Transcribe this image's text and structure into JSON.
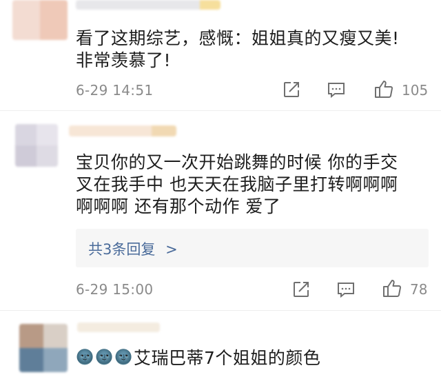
{
  "comments": [
    {
      "text_lines": [
        "看了这期综艺，感慨：姐姐真的又瘦又美!",
        "非常羡慕了!"
      ],
      "timestamp": "6-29 14:51",
      "likes": "105"
    },
    {
      "text_lines": [
        "宝贝你的又一次开始跳舞的时候 你的手交",
        "叉在我手中  也天天在我脑子里打转啊啊啊",
        "啊啊啊 还有那个动作 爱了"
      ],
      "replies_label": "共3条回复",
      "replies_chevron": ">",
      "timestamp": "6-29 15:00",
      "likes": "78"
    },
    {
      "emoji": [
        "🌚",
        "🌚",
        "🌚"
      ],
      "text": "艾瑞巴蒂7个姐姐的颜色"
    }
  ],
  "icons": {
    "share": "share-icon",
    "comment": "comment-icon",
    "like": "thumbs-up-icon"
  },
  "colors": {
    "link": "#4a6b9a",
    "meta": "#8a8a8a",
    "reply_bg": "#f6f6f6"
  }
}
